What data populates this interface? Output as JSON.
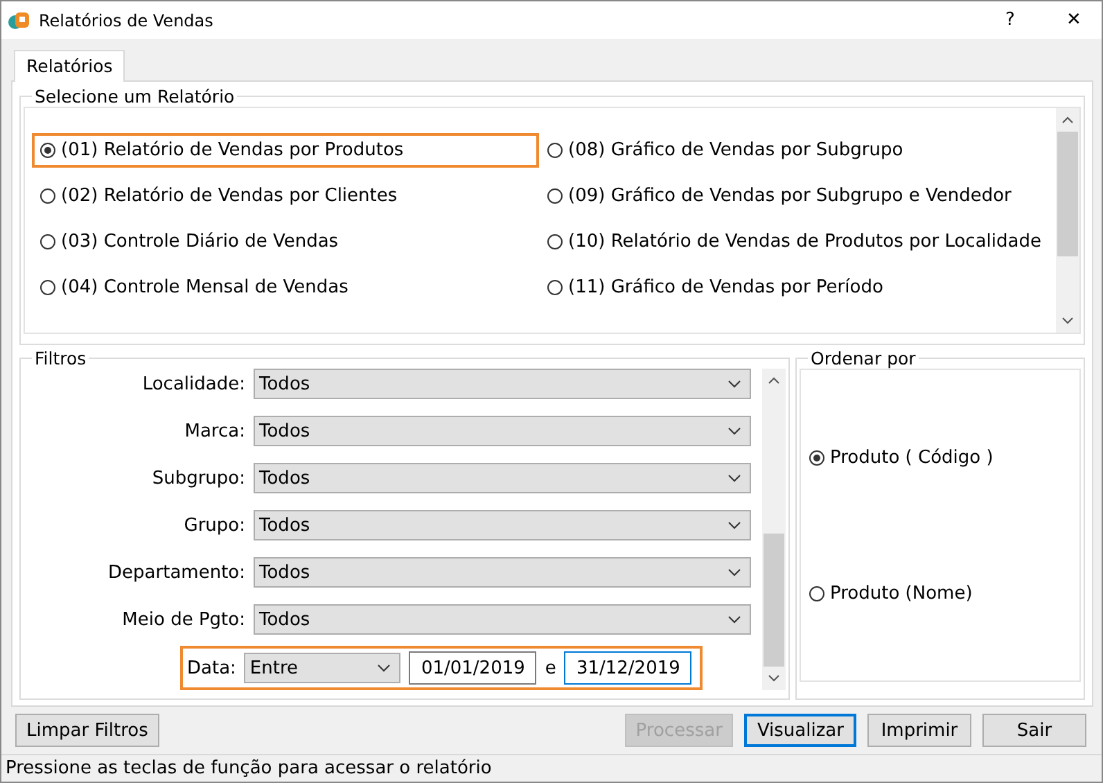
{
  "window": {
    "title": "Relatórios de Vendas",
    "help": "?",
    "close": "✕"
  },
  "tabs": [
    {
      "label": "Relatórios",
      "selected": true
    }
  ],
  "reports": {
    "title": "Selecione um Relatório",
    "items": [
      {
        "label": "(01) Relatório de Vendas por Produtos",
        "selected": true,
        "highlighted": true
      },
      {
        "label": "(02) Relatório de Vendas por Clientes",
        "selected": false,
        "highlighted": false
      },
      {
        "label": "(03) Controle Diário de Vendas",
        "selected": false,
        "highlighted": false
      },
      {
        "label": "(04) Controle Mensal de Vendas",
        "selected": false,
        "highlighted": false
      },
      {
        "label": "(08) Gráfico de Vendas por Subgrupo",
        "selected": false,
        "highlighted": false
      },
      {
        "label": "(09) Gráfico de Vendas por Subgrupo e Vendedor",
        "selected": false,
        "highlighted": false
      },
      {
        "label": "(10) Relatório de Vendas de Produtos por Localidade",
        "selected": false,
        "highlighted": false
      },
      {
        "label": "(11) Gráfico de Vendas por Período",
        "selected": false,
        "highlighted": false
      }
    ]
  },
  "filters": {
    "title": "Filtros",
    "fields": [
      {
        "kind": "select",
        "label": "Localidade:",
        "value": "Todos"
      },
      {
        "kind": "select",
        "label": "Marca:",
        "value": "Todos"
      },
      {
        "kind": "select",
        "label": "Subgrupo:",
        "value": "Todos"
      },
      {
        "kind": "select",
        "label": "Grupo:",
        "value": "Todos"
      },
      {
        "kind": "select",
        "label": "Departamento:",
        "value": "Todos"
      },
      {
        "kind": "select",
        "label": "Meio de Pgto:",
        "value": "Todos"
      },
      {
        "kind": "date_range",
        "label": "Data:",
        "value": "Entre",
        "from": "01/01/2019",
        "separator": "e",
        "to": "31/12/2019",
        "highlighted": true
      }
    ]
  },
  "order": {
    "title": "Ordenar por",
    "options": [
      {
        "label": "Produto ( Código )",
        "selected": true
      },
      {
        "label": "Produto (Nome)",
        "selected": false
      }
    ]
  },
  "buttons": [
    {
      "label": "Limpar Filtros",
      "disabled": false,
      "focused": false
    },
    {
      "label": "Processar",
      "disabled": true,
      "focused": false
    },
    {
      "label": "Visualizar",
      "disabled": false,
      "focused": true
    },
    {
      "label": "Imprimir",
      "disabled": false,
      "focused": false
    },
    {
      "label": "Sair",
      "disabled": false,
      "focused": false
    }
  ],
  "status_bar": "Pressione as teclas de função para acessar o relatório"
}
